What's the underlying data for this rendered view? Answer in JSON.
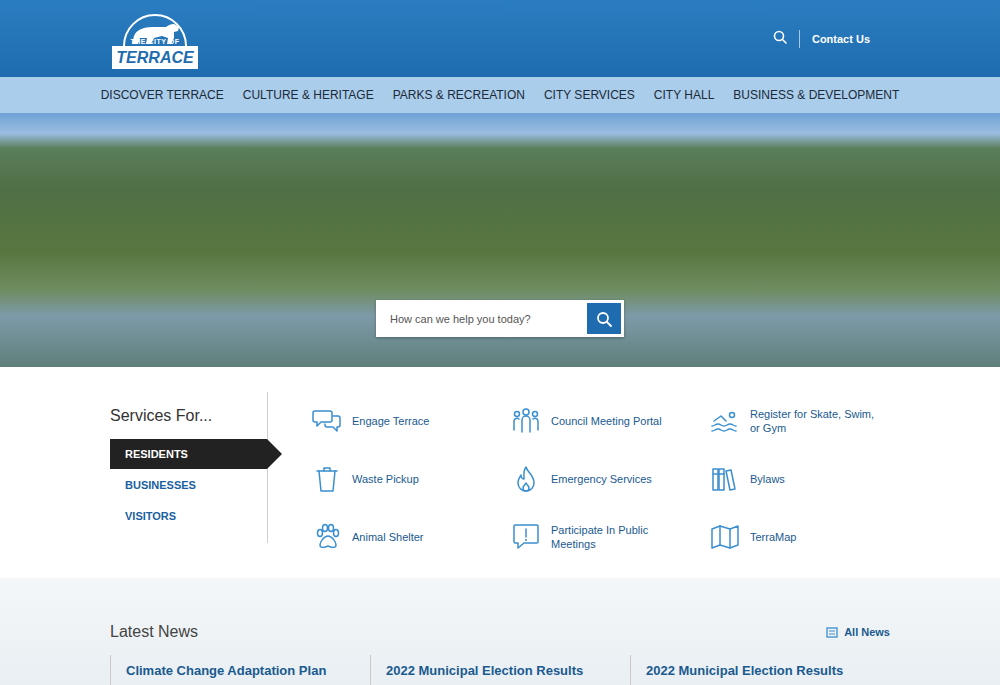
{
  "header": {
    "logo": {
      "top": "THE CITY OF",
      "name": "TERRACE"
    },
    "contact": "Contact Us"
  },
  "nav": [
    "DISCOVER TERRACE",
    "CULTURE & HERITAGE",
    "PARKS & RECREATION",
    "CITY SERVICES",
    "CITY HALL",
    "BUSINESS & DEVELOPMENT"
  ],
  "hero": {
    "search": {
      "placeholder": "How can we help you today?"
    }
  },
  "services": {
    "title": "Services For...",
    "tabs": [
      {
        "label": "RESIDENTS",
        "selected": true
      },
      {
        "label": "BUSINESSES",
        "selected": false
      },
      {
        "label": "VISITORS",
        "selected": false
      }
    ],
    "items": [
      {
        "label": "Engage Terrace",
        "kind": "chat"
      },
      {
        "label": "Council Meeting Portal",
        "kind": "people"
      },
      {
        "label": "Register for Skate, Swim, or Gym",
        "kind": "swim"
      },
      {
        "label": "Waste Pickup",
        "kind": "trash"
      },
      {
        "label": "Emergency Services",
        "kind": "flame"
      },
      {
        "label": "Bylaws",
        "kind": "books"
      },
      {
        "label": "Animal Shelter",
        "kind": "paw"
      },
      {
        "label": "Participate In Public Meetings",
        "kind": "alert"
      },
      {
        "label": "TerraMap",
        "kind": "map"
      }
    ]
  },
  "news": {
    "title": "Latest News",
    "all": "All News",
    "articles": [
      {
        "title": "Climate Change Adaptation Plan"
      },
      {
        "title": "2022 Municipal Election Results"
      },
      {
        "title": "2022 Municipal Election Results"
      }
    ]
  }
}
